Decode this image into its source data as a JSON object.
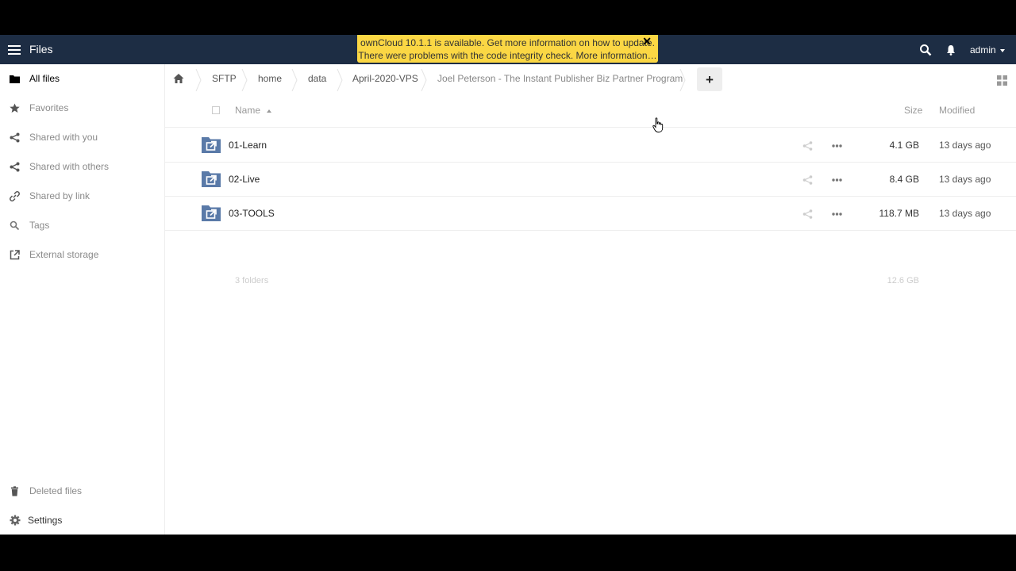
{
  "app": {
    "title": "Files"
  },
  "header": {
    "user": "admin"
  },
  "notification": {
    "line1": "ownCloud 10.1.1 is available. Get more information on how to update.",
    "line2": "There were problems with the code integrity check. More information…",
    "close": "✕"
  },
  "sidebar": {
    "items": [
      {
        "label": "All files",
        "icon": "folder-icon"
      },
      {
        "label": "Favorites",
        "icon": "star-icon"
      },
      {
        "label": "Shared with you",
        "icon": "share-icon"
      },
      {
        "label": "Shared with others",
        "icon": "share-icon"
      },
      {
        "label": "Shared by link",
        "icon": "link-icon"
      },
      {
        "label": "Tags",
        "icon": "tag-icon"
      },
      {
        "label": "External storage",
        "icon": "external-icon"
      }
    ],
    "bottom": [
      {
        "label": "Deleted files",
        "icon": "trash-icon"
      },
      {
        "label": "Settings",
        "icon": "gear-icon"
      }
    ]
  },
  "breadcrumbs": [
    "SFTP",
    "home",
    "data",
    "April-2020-VPS",
    "Joel Peterson - The Instant Publisher Biz Partner Program"
  ],
  "new_button": "+",
  "table": {
    "headers": {
      "name": "Name",
      "size": "Size",
      "modified": "Modified"
    },
    "rows": [
      {
        "name": "01-Learn",
        "size": "4.1 GB",
        "modified": "13 days ago"
      },
      {
        "name": "02-Live",
        "size": "8.4 GB",
        "modified": "13 days ago"
      },
      {
        "name": "03-TOOLS",
        "size": "118.7 MB",
        "modified": "13 days ago"
      }
    ],
    "summary": {
      "count": "3 folders",
      "size": "12.6 GB"
    }
  },
  "colors": {
    "header_bg": "#1d2d44",
    "banner_bg": "#fbd744",
    "folder_blue": "#5a7aa8"
  }
}
